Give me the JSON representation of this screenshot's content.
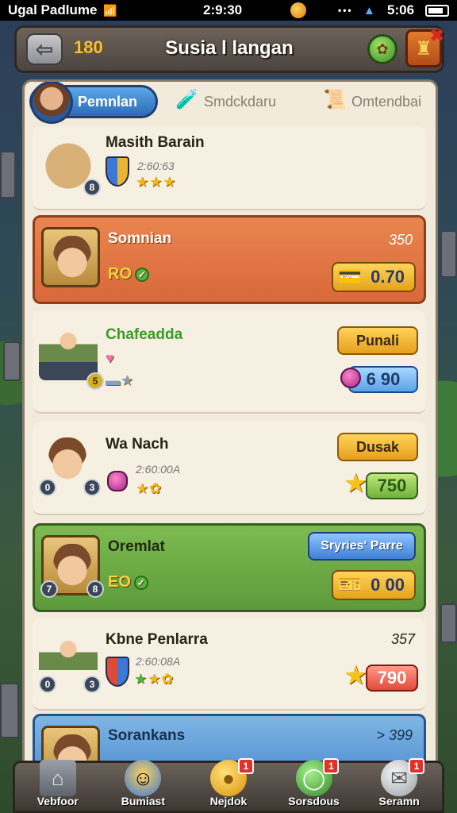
{
  "status_bar": {
    "carrier": "Ugal Padlume",
    "time_center": "2:9:30",
    "time_right": "5:06"
  },
  "topbar": {
    "coins": "180",
    "title": "Susia l langan"
  },
  "tabs": [
    {
      "label": "Pemnlan"
    },
    {
      "label": "Smdckdaru"
    },
    {
      "label": "Omtendbai"
    }
  ],
  "rows": [
    {
      "name": "Masith Barain",
      "sub": "2:60:63",
      "level_left": "",
      "level_right": "8"
    },
    {
      "name": "Somnian",
      "amount": "350",
      "value": "RO",
      "level_left": "",
      "level_right": "",
      "price": "0.70"
    },
    {
      "name": "Chafeadda",
      "action": "Punali",
      "price": "6 90",
      "level_left": "",
      "level_right": "5"
    },
    {
      "name": "Wa Nach",
      "sub": "2:60:00A",
      "action": "Dusak",
      "value": "750",
      "level_left": "0",
      "level_right": "3"
    },
    {
      "name": "Oremlat",
      "action": "Sryries' Parre",
      "value": "EO",
      "price": "0 00",
      "level_left": "7",
      "level_right": "8"
    },
    {
      "name": "Kbne Penlarra",
      "sub": "2:60:08A",
      "amount": "357",
      "value": "790",
      "level_left": "0",
      "level_right": "3"
    },
    {
      "name": "Sorankans",
      "amount": "> 399"
    }
  ],
  "bottom_nav": [
    {
      "label": "Vebfoor",
      "icon": "castle-icon",
      "badge": ""
    },
    {
      "label": "Bumiast",
      "icon": "hero-icon",
      "badge": ""
    },
    {
      "label": "Nejdok",
      "icon": "gold-coin-icon",
      "badge": "1"
    },
    {
      "label": "Sorsdous",
      "icon": "orb-icon",
      "badge": "1"
    },
    {
      "label": "Seramn",
      "icon": "chat-icon",
      "badge": "1"
    }
  ],
  "colors": {
    "accent_orange": "#d9683a",
    "accent_green": "#5d9a3a",
    "accent_blue": "#4c8bd0",
    "gold": "#f2c040"
  }
}
